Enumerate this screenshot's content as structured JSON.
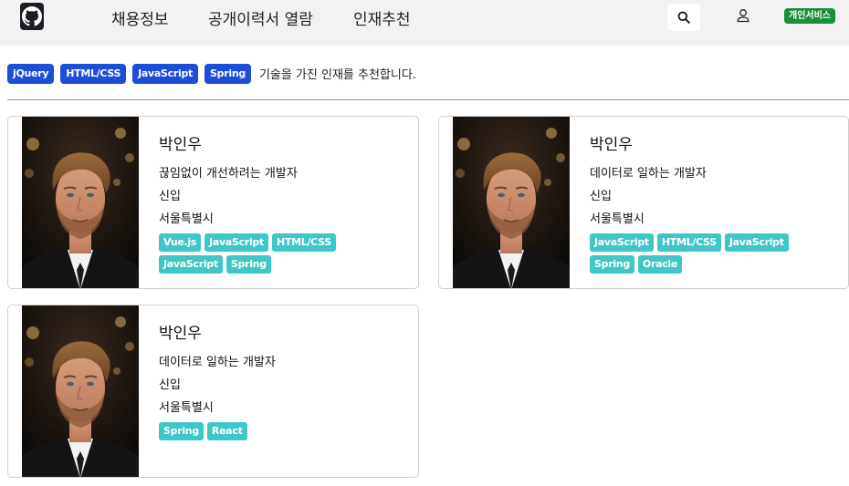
{
  "nav": {
    "links": [
      "채용정보",
      "공개이력서 열람",
      "인재추천"
    ],
    "service_label": "개인서비스"
  },
  "filter": {
    "skills": [
      "jQuery",
      "HTML/CSS",
      "JavaScript",
      "Spring"
    ],
    "text": "기술을 가진 인재를 추천합니다."
  },
  "cards": [
    {
      "name": "박인우",
      "headline": "끊임없이 개선하려는 개발자",
      "career": "신입",
      "location": "서울특별시",
      "tags": [
        "Vue.js",
        "JavaScript",
        "HTML/CSS",
        "JavaScript",
        "Spring"
      ]
    },
    {
      "name": "박인우",
      "headline": "데이터로 일하는 개발자",
      "career": "신입",
      "location": "서울특별시",
      "tags": [
        "JavaScript",
        "HTML/CSS",
        "JavaScript",
        "Spring",
        "Oracle"
      ]
    },
    {
      "name": "박인우",
      "headline": "데이터로 일하는 개발자",
      "career": "신입",
      "location": "서울특별시",
      "tags": [
        "Spring",
        "React"
      ]
    }
  ],
  "colors": {
    "filter_chip": "#1d4ed8",
    "skill_tag": "#3fc7c7",
    "service_button": "#1a8f3c",
    "navbar_bg": "#f2f2f2"
  }
}
